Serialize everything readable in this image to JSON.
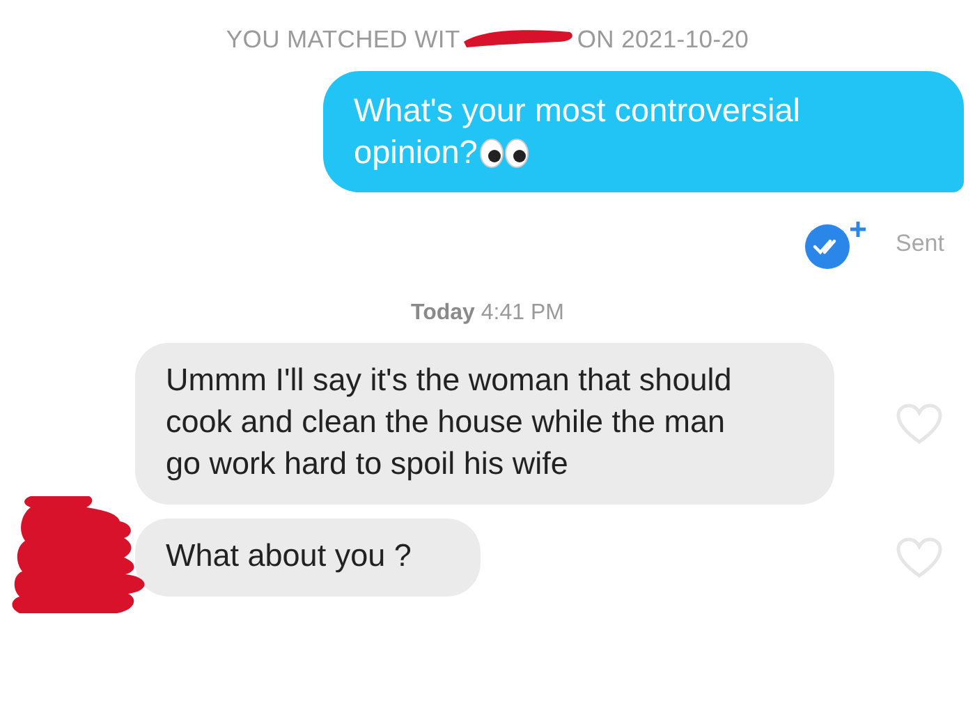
{
  "match_banner": {
    "before": "YOU MATCHED WIT",
    "after": "ON 2021-10-20"
  },
  "messages": [
    {
      "kind": "sent",
      "text": "What's your most controversial opinion?",
      "eyes": true,
      "status": "Sent",
      "read": true
    },
    {
      "kind": "timestamp",
      "day": "Today",
      "time": "4:41 PM"
    },
    {
      "kind": "received",
      "text": "Ummm I'll say it's the woman that should cook and clean the house while the man go work hard to spoil his wife",
      "liked": false
    },
    {
      "kind": "received",
      "text": "What about you ?",
      "liked": false,
      "avatar": true
    }
  ]
}
